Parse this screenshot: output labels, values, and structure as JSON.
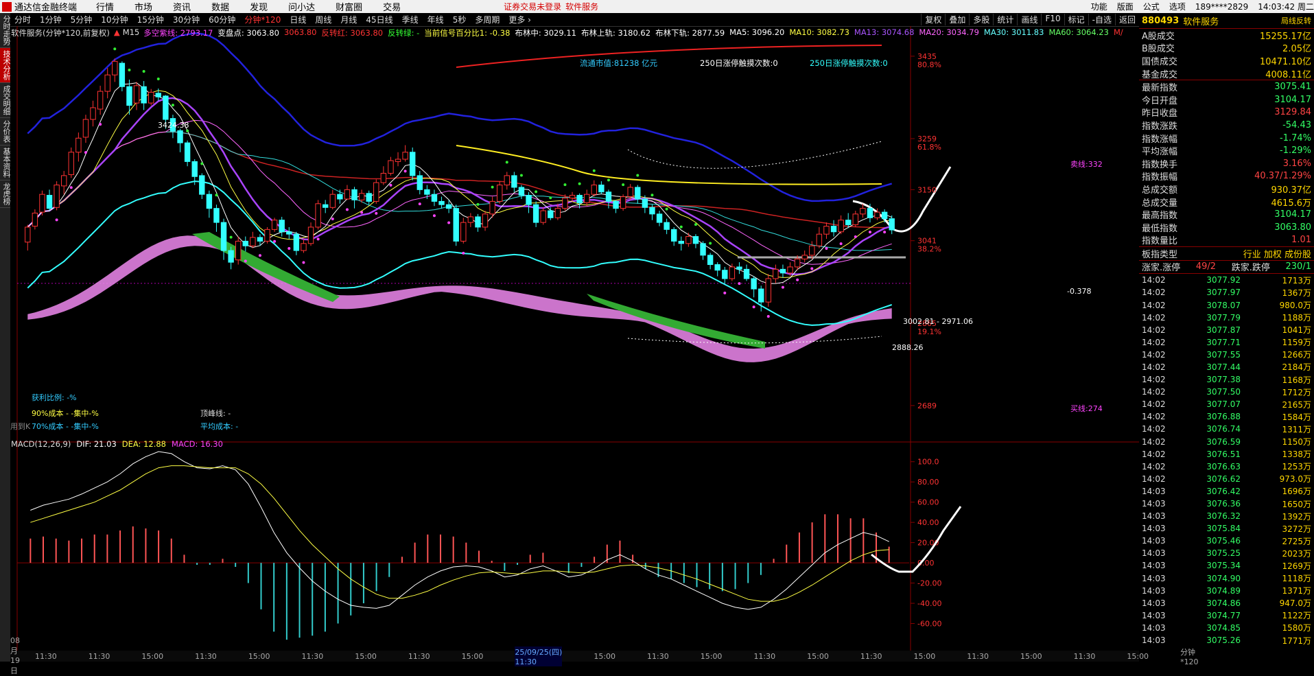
{
  "menubar": {
    "app_title": "通达信金融终端",
    "menus": [
      "行情",
      "市场",
      "资讯",
      "数据",
      "发现",
      "问小达",
      "财富圈",
      "交易"
    ],
    "warning": "证券交易未登录",
    "service": "软件服务",
    "right": [
      "功能",
      "版面",
      "公式",
      "选项"
    ],
    "account": "189****2829",
    "time": "14:03:42 周二"
  },
  "periods": [
    "分时",
    "1分钟",
    "5分钟",
    "10分钟",
    "15分钟",
    "30分钟",
    "60分钟",
    "分钟*120",
    "日线",
    "周线",
    "月线",
    "45日线",
    "季线",
    "年线",
    "5秒",
    "多周期",
    "更多 ›"
  ],
  "toolbar_right": [
    "复权",
    "叠加",
    "多股",
    "统计",
    "画线",
    "F10",
    "标记",
    "-自选",
    "返回"
  ],
  "left_tabs": [
    "分时走势",
    "技术分析",
    "成交明细",
    "分价表",
    "基本资料",
    "龙虎榜"
  ],
  "indicator_line": {
    "title": "软件服务(分钟*120,前复权)",
    "m15": "M15",
    "items": [
      {
        "label": "多空紫线: 2793.17",
        "color": "#ff44ff"
      },
      {
        "label": "变盘点: 3063.80",
        "color": "#ffffff"
      },
      {
        "label": "3063.80",
        "color": "#ff3333"
      },
      {
        "label": "反转红: 3063.80",
        "color": "#ff3333"
      },
      {
        "label": "反转绿: -",
        "color": "#33ff33"
      },
      {
        "label": "当前信号百分比1: -0.38",
        "color": "#ffff44"
      },
      {
        "label": "布林中: 3029.11",
        "color": "#ffffff"
      },
      {
        "label": "布林上轨: 3180.62",
        "color": "#ffffff"
      },
      {
        "label": "布林下轨: 2877.59",
        "color": "#ffffff"
      },
      {
        "label": "MA5: 3096.20",
        "color": "#ffffff"
      },
      {
        "label": "MA10: 3082.73",
        "color": "#ffff44"
      },
      {
        "label": "MA13: 3074.68",
        "color": "#aa55ff"
      },
      {
        "label": "MA20: 3034.79",
        "color": "#ff66ff"
      },
      {
        "label": "MA30: 3011.83",
        "color": "#66ffff"
      },
      {
        "label": "MA60: 3064.23",
        "color": "#66ff66"
      },
      {
        "label": "M/",
        "color": "#ff3333"
      }
    ]
  },
  "chart_notes": {
    "market_cap": "流通市值:81238 亿元",
    "limit1": "250日涨停触摸次数:0",
    "limit2": "250日涨停触摸次数:0",
    "high_label": "3424.38",
    "low_label": "2888.26",
    "range_label": "3002.81 - 2971.06",
    "pct_label": "-0.378",
    "sell_line": "卖线:332",
    "buy_line": "买线:274",
    "profit_ratio": "获利比例: -%",
    "cost90": "90%成本 - -集中-%",
    "cost70": "70%成本 - -集中-%",
    "top": "顶峰线: -",
    "avg_cost": "平均成本: -",
    "use": "用到K"
  },
  "price_axis": [
    {
      "v": "3435",
      "p": "80.8%"
    },
    {
      "v": "3259",
      "p": "61.8%"
    },
    {
      "v": "3150",
      "p": ""
    },
    {
      "v": "3041",
      "p": "38.2%"
    },
    {
      "v": "2865",
      "p": "19.1%"
    },
    {
      "v": "2689",
      "p": ""
    }
  ],
  "macd": {
    "title": "MACD(12,26,9)",
    "dif": "DIF: 21.03",
    "dea": "DEA: 12.88",
    "macd": "MACD: 16.30",
    "axis": [
      "100.0",
      "80.00",
      "60.00",
      "40.00",
      "20.00",
      "0.00",
      "-20.00",
      "-40.00",
      "-60.00"
    ],
    "dif_series": [
      52,
      57,
      60,
      63,
      68,
      74,
      80,
      88,
      98,
      105,
      110,
      108,
      100,
      94,
      93,
      96,
      92,
      78,
      55,
      30,
      10,
      -5,
      -18,
      -28,
      -36,
      -42,
      -44,
      -45,
      -42,
      -32,
      -22,
      -14,
      -8,
      -4,
      -3,
      -4,
      -8,
      -14,
      -12,
      -6,
      -3,
      -8,
      -14,
      -12,
      -6,
      3,
      8,
      2,
      -6,
      -12,
      -16,
      -22,
      -28,
      -34,
      -40,
      -44,
      -46,
      -44,
      -36,
      -26,
      -14,
      -2,
      10,
      18,
      24,
      30,
      27,
      21
    ],
    "dea_series": [
      40,
      44,
      48,
      52,
      56,
      60,
      66,
      72,
      80,
      88,
      94,
      96,
      96,
      95,
      94,
      94,
      94,
      88,
      78,
      64,
      48,
      32,
      18,
      6,
      -6,
      -16,
      -24,
      -31,
      -35,
      -35,
      -32,
      -28,
      -22,
      -17,
      -13,
      -10,
      -9,
      -10,
      -11,
      -10,
      -8,
      -8,
      -9,
      -10,
      -9,
      -6,
      -3,
      -2,
      -3,
      -5,
      -8,
      -12,
      -16,
      -21,
      -26,
      -31,
      -36,
      -38,
      -38,
      -35,
      -29,
      -22,
      -14,
      -6,
      2,
      8,
      12,
      13
    ],
    "hist_series": [
      24,
      26,
      24,
      22,
      24,
      28,
      28,
      32,
      36,
      34,
      32,
      24,
      8,
      -2,
      -2,
      4,
      -4,
      -20,
      -46,
      -68,
      -76,
      -74,
      -72,
      -68,
      -60,
      -52,
      -40,
      -28,
      -14,
      6,
      20,
      28,
      28,
      26,
      20,
      12,
      2,
      -8,
      -2,
      8,
      10,
      0,
      -10,
      -4,
      6,
      18,
      22,
      8,
      -6,
      -14,
      -16,
      -20,
      -24,
      -26,
      -28,
      -26,
      -20,
      -12,
      4,
      18,
      30,
      40,
      48,
      48,
      44,
      44,
      30,
      16
    ]
  },
  "candles": [
    [
      3038,
      3070,
      3020,
      3075
    ],
    [
      3072,
      3100,
      3065,
      3108
    ],
    [
      3102,
      3140,
      3095,
      3148
    ],
    [
      3138,
      3110,
      3105,
      3150
    ],
    [
      3112,
      3160,
      3106,
      3168
    ],
    [
      3158,
      3180,
      3140,
      3190
    ],
    [
      3182,
      3230,
      3175,
      3240
    ],
    [
      3230,
      3260,
      3210,
      3272
    ],
    [
      3262,
      3300,
      3250,
      3310
    ],
    [
      3300,
      3325,
      3285,
      3340
    ],
    [
      3322,
      3360,
      3310,
      3372
    ],
    [
      3360,
      3395,
      3345,
      3410
    ],
    [
      3395,
      3424,
      3380,
      3430
    ],
    [
      3420,
      3370,
      3360,
      3424
    ],
    [
      3370,
      3330,
      3310,
      3385
    ],
    [
      3335,
      3372,
      3320,
      3380
    ],
    [
      3370,
      3335,
      3320,
      3382
    ],
    [
      3335,
      3358,
      3330,
      3365
    ],
    [
      3356,
      3348,
      3340,
      3366
    ],
    [
      3350,
      3300,
      3280,
      3352
    ],
    [
      3302,
      3275,
      3260,
      3310
    ],
    [
      3276,
      3250,
      3230,
      3280
    ],
    [
      3250,
      3210,
      3200,
      3255
    ],
    [
      3210,
      3178,
      3160,
      3215
    ],
    [
      3180,
      3140,
      3130,
      3185
    ],
    [
      3140,
      3110,
      3090,
      3148
    ],
    [
      3110,
      3080,
      3060,
      3118
    ],
    [
      3080,
      3020,
      3000,
      3088
    ],
    [
      3020,
      2995,
      2980,
      3028
    ],
    [
      3000,
      3040,
      2990,
      3050
    ],
    [
      3040,
      3030,
      3018,
      3050
    ],
    [
      3030,
      3048,
      3025,
      3060
    ],
    [
      3048,
      3040,
      3030,
      3055
    ],
    [
      3040,
      3065,
      3035,
      3070
    ],
    [
      3065,
      3085,
      3060,
      3090
    ],
    [
      3085,
      3060,
      3050,
      3092
    ],
    [
      3060,
      3055,
      3045,
      3070
    ],
    [
      3055,
      3020,
      3010,
      3060
    ],
    [
      3020,
      3035,
      3015,
      3045
    ],
    [
      3035,
      3070,
      3030,
      3080
    ],
    [
      3070,
      3120,
      3065,
      3128
    ],
    [
      3118,
      3112,
      3100,
      3128
    ],
    [
      3112,
      3140,
      3108,
      3150
    ],
    [
      3140,
      3130,
      3120,
      3150
    ],
    [
      3130,
      3150,
      3128,
      3160
    ],
    [
      3150,
      3128,
      3110,
      3156
    ],
    [
      3128,
      3142,
      3122,
      3150
    ],
    [
      3142,
      3125,
      3118,
      3148
    ],
    [
      3125,
      3165,
      3120,
      3172
    ],
    [
      3165,
      3185,
      3160,
      3200
    ],
    [
      3185,
      3212,
      3180,
      3220
    ],
    [
      3210,
      3215,
      3200,
      3230
    ],
    [
      3215,
      3230,
      3210,
      3245
    ],
    [
      3230,
      3180,
      3170,
      3240
    ],
    [
      3180,
      3150,
      3140,
      3190
    ],
    [
      3150,
      3140,
      3130,
      3160
    ],
    [
      3140,
      3125,
      3115,
      3150
    ],
    [
      3125,
      3118,
      3110,
      3135
    ],
    [
      3118,
      3110,
      3100,
      3128
    ],
    [
      3110,
      3040,
      3030,
      3118
    ],
    [
      3040,
      3080,
      3035,
      3090
    ],
    [
      3080,
      3092,
      3070,
      3100
    ],
    [
      3092,
      3070,
      3060,
      3098
    ],
    [
      3070,
      3098,
      3062,
      3105
    ],
    [
      3098,
      3125,
      3090,
      3135
    ],
    [
      3125,
      3160,
      3120,
      3168
    ],
    [
      3160,
      3180,
      3150,
      3188
    ],
    [
      3180,
      3155,
      3145,
      3188
    ],
    [
      3155,
      3138,
      3130,
      3160
    ],
    [
      3138,
      3118,
      3100,
      3145
    ],
    [
      3118,
      3080,
      3070,
      3125
    ],
    [
      3080,
      3105,
      3075,
      3112
    ],
    [
      3105,
      3090,
      3085,
      3112
    ],
    [
      3090,
      3110,
      3085,
      3120
    ],
    [
      3110,
      3132,
      3105,
      3140
    ],
    [
      3132,
      3138,
      3125,
      3145
    ],
    [
      3138,
      3122,
      3110,
      3142
    ],
    [
      3122,
      3140,
      3115,
      3150
    ],
    [
      3140,
      3160,
      3135,
      3170
    ],
    [
      3160,
      3145,
      3140,
      3168
    ],
    [
      3145,
      3125,
      3110,
      3150
    ],
    [
      3125,
      3110,
      3100,
      3128
    ],
    [
      3110,
      3135,
      3105,
      3140
    ],
    [
      3135,
      3155,
      3128,
      3162
    ],
    [
      3155,
      3130,
      3120,
      3160
    ],
    [
      3130,
      3112,
      3100,
      3138
    ],
    [
      3112,
      3098,
      3085,
      3118
    ],
    [
      3098,
      3080,
      3072,
      3105
    ],
    [
      3080,
      3065,
      3055,
      3088
    ],
    [
      3065,
      3040,
      3030,
      3070
    ],
    [
      3040,
      3035,
      3020,
      3050
    ],
    [
      3035,
      3050,
      3028,
      3058
    ],
    [
      3050,
      3035,
      3025,
      3055
    ],
    [
      3035,
      3010,
      3000,
      3040
    ],
    [
      3010,
      2990,
      2980,
      3015
    ],
    [
      2990,
      2978,
      2965,
      2995
    ],
    [
      2978,
      2960,
      2950,
      2985
    ],
    [
      2960,
      2985,
      2955,
      2992
    ],
    [
      2985,
      2980,
      2970,
      2995
    ],
    [
      2980,
      2960,
      2955,
      2990
    ],
    [
      2960,
      2938,
      2920,
      2965
    ],
    [
      2938,
      2910,
      2890,
      2945
    ],
    [
      2910,
      2960,
      2900,
      2970
    ],
    [
      2960,
      2980,
      2950,
      2990
    ],
    [
      2980,
      2972,
      2962,
      2990
    ],
    [
      2972,
      2985,
      2965,
      2995
    ],
    [
      2985,
      3002,
      2978,
      3010
    ],
    [
      3002,
      3010,
      2995,
      3020
    ],
    [
      3010,
      3030,
      3002,
      3040
    ],
    [
      3030,
      3055,
      3025,
      3070
    ],
    [
      3055,
      3072,
      3045,
      3080
    ],
    [
      3072,
      3060,
      3050,
      3085
    ],
    [
      3060,
      3085,
      3055,
      3095
    ],
    [
      3085,
      3075,
      3068,
      3100
    ],
    [
      3075,
      3098,
      3070,
      3105
    ],
    [
      3098,
      3110,
      3090,
      3120
    ],
    [
      3110,
      3090,
      3080,
      3120
    ],
    [
      3090,
      3102,
      3085,
      3110
    ],
    [
      3102,
      3088,
      3080,
      3108
    ],
    [
      3088,
      3064,
      3055,
      3095
    ]
  ],
  "right_panel": {
    "code": "880493",
    "name": "软件服务",
    "tag": "局线反转",
    "summary": [
      {
        "k": "A股成交",
        "v": "15255.17亿",
        "c": "y"
      },
      {
        "k": "B股成交",
        "v": "2.05亿",
        "c": "y"
      },
      {
        "k": "国债成交",
        "v": "10471.10亿",
        "c": "y"
      },
      {
        "k": "基金成交",
        "v": "4008.11亿",
        "c": "y"
      }
    ],
    "stats": [
      {
        "k": "最新指数",
        "v": "3075.41",
        "c": "g"
      },
      {
        "k": "今日开盘",
        "v": "3104.17",
        "c": "g"
      },
      {
        "k": "昨日收盘",
        "v": "3129.84",
        "c": ""
      },
      {
        "k": "指数涨跌",
        "v": "-54.43",
        "c": "g"
      },
      {
        "k": "指数涨幅",
        "v": "-1.74%",
        "c": "g"
      },
      {
        "k": "平均涨幅",
        "v": "-1.29%",
        "c": "g"
      },
      {
        "k": "指数换手",
        "v": "3.16%",
        "c": ""
      },
      {
        "k": "指数振幅",
        "v": "40.37/1.29%",
        "c": ""
      },
      {
        "k": "总成交额",
        "v": "930.37亿",
        "c": "y"
      },
      {
        "k": "总成交量",
        "v": "4615.6万",
        "c": "y"
      },
      {
        "k": "最高指数",
        "v": "3104.17",
        "c": "g"
      },
      {
        "k": "最低指数",
        "v": "3063.80",
        "c": "g"
      },
      {
        "k": "指数量比",
        "v": "1.01",
        "c": ""
      }
    ],
    "sector": {
      "k": "板指类型",
      "v": "行业 加权 成份股"
    },
    "updown": {
      "up": "涨家.涨停",
      "upv": "49/2",
      "down": "跌家.跌停",
      "downv": "230/1"
    },
    "ticks": [
      [
        "14:02",
        "3077.92",
        "1713万"
      ],
      [
        "14:02",
        "3077.97",
        "1367万"
      ],
      [
        "14:02",
        "3078.07",
        "980.0万"
      ],
      [
        "14:02",
        "3077.79",
        "1188万"
      ],
      [
        "14:02",
        "3077.87",
        "1041万"
      ],
      [
        "14:02",
        "3077.71",
        "1159万"
      ],
      [
        "14:02",
        "3077.55",
        "1266万"
      ],
      [
        "14:02",
        "3077.44",
        "2184万"
      ],
      [
        "14:02",
        "3077.38",
        "1168万"
      ],
      [
        "14:02",
        "3077.50",
        "1712万"
      ],
      [
        "14:02",
        "3077.07",
        "2165万"
      ],
      [
        "14:02",
        "3076.88",
        "1584万"
      ],
      [
        "14:02",
        "3076.74",
        "1311万"
      ],
      [
        "14:02",
        "3076.59",
        "1150万"
      ],
      [
        "14:02",
        "3076.51",
        "1338万"
      ],
      [
        "14:02",
        "3076.63",
        "1253万"
      ],
      [
        "14:02",
        "3076.62",
        "973.0万"
      ],
      [
        "14:03",
        "3076.42",
        "1696万"
      ],
      [
        "14:03",
        "3076.36",
        "1650万"
      ],
      [
        "14:03",
        "3076.32",
        "1392万"
      ],
      [
        "14:03",
        "3075.84",
        "3272万"
      ],
      [
        "14:03",
        "3075.46",
        "2725万"
      ],
      [
        "14:03",
        "3075.25",
        "2023万"
      ],
      [
        "14:03",
        "3075.34",
        "1269万"
      ],
      [
        "14:03",
        "3074.90",
        "1118万"
      ],
      [
        "14:03",
        "3074.89",
        "1371万"
      ],
      [
        "14:03",
        "3074.86",
        "947.0万"
      ],
      [
        "14:03",
        "3074.77",
        "1122万"
      ],
      [
        "14:03",
        "3074.85",
        "1580万"
      ],
      [
        "14:03",
        "3075.26",
        "1771万"
      ]
    ]
  },
  "x_axis": {
    "labels": [
      "08月19日",
      "11:30",
      "11:30",
      "15:00",
      "11:30",
      "15:00",
      "11:30",
      "15:00",
      "11:30",
      "15:00",
      "25/09/25(四) 11:30",
      "15:00",
      "11:30",
      "15:00",
      "11:30",
      "15:00",
      "11:30",
      "15:00",
      "11:30",
      "15:00",
      "11:30",
      "15:00"
    ],
    "period": "分钟*120"
  },
  "colors": {
    "up": "#ff3333",
    "down": "#33ffff",
    "bg": "#000000",
    "accent": "#ffd700"
  }
}
